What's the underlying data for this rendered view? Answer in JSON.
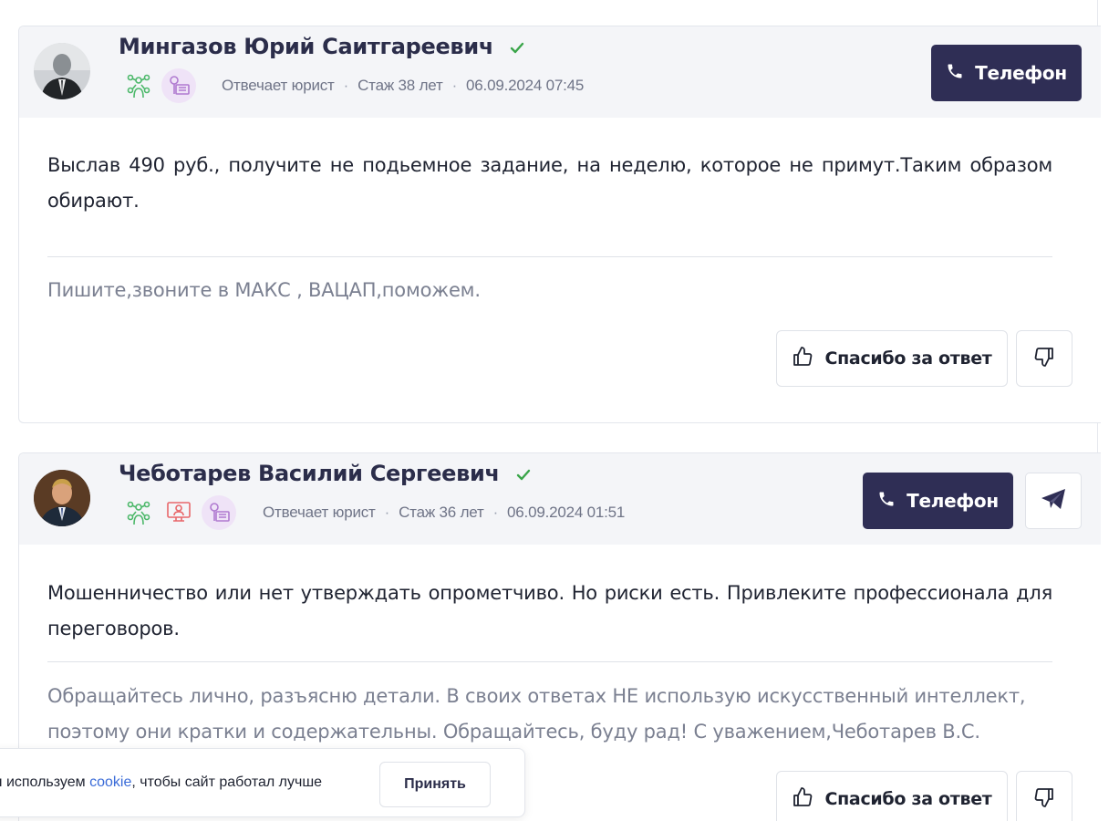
{
  "answers": [
    {
      "name": "Мингазов Юрий Саитгареевич",
      "meta": {
        "role": "Отвечает юрист",
        "experience": "Стаж 38 лет",
        "datetime": "06.09.2024 07:45"
      },
      "phone_label": "Телефон",
      "text": "Выслав 490 руб., получите не подьемное задание, на неделю, которое не примут.Таким образом обирают.",
      "signature": "Пишите,звоните в МАКС , ВАЦАП,поможем.",
      "thanks_label": "Спасибо за ответ"
    },
    {
      "name": "Чеботарев Василий Сергеевич",
      "meta": {
        "role": "Отвечает юрист",
        "experience": "Стаж 36 лет",
        "datetime": "06.09.2024 01:51"
      },
      "phone_label": "Телефон",
      "text": "Мошенничество или нет утверждать опрометчиво. Но риски есть. Привлеките профессионала для переговоров.",
      "signature": "Обращайтесь лично, разъясню детали. В своих ответах НЕ использую искусственный интеллект, поэтому они кратки и содержательны. Обращайтесь, буду рад! С уважением,Чеботарев В.С.",
      "thanks_label": "Спасибо за ответ"
    }
  ],
  "cookie": {
    "text_before": "ы используем ",
    "link": "cookie",
    "text_after": ", чтобы сайт работал лучше",
    "accept_label": "Принять"
  },
  "colors": {
    "primary_button": "#2f2e55",
    "verified": "#3aa54a",
    "badge_green": "#4cb86a",
    "badge_red": "#e8676a",
    "badge_purple": "#b07ad0",
    "cookie_link": "#3a6bd8"
  },
  "icons": {
    "verified": "check-icon",
    "phone": "phone-icon",
    "telegram": "paper-plane-icon",
    "like": "thumbs-up-icon",
    "dislike": "thumbs-down-icon"
  }
}
